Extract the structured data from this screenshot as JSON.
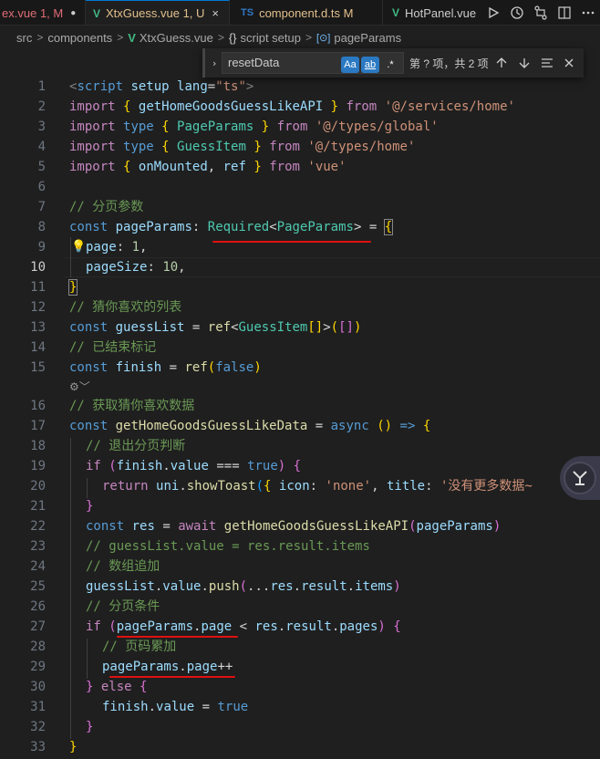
{
  "tabs": [
    {
      "name": "ex.vue",
      "status": "1, M",
      "modified_dot": "●",
      "color": "#e06c75"
    },
    {
      "name": "XtxGuess.vue",
      "status": "1, U",
      "close": "×",
      "color": "#e2c08d",
      "icon": "V"
    },
    {
      "name": "component.d.ts",
      "status": "M",
      "color": "#e2c08d",
      "icon": "TS"
    },
    {
      "name": "HotPanel.vue",
      "icon": "V"
    }
  ],
  "breadcrumb": {
    "items": [
      "src",
      "components",
      "XtxGuess.vue",
      "script setup",
      "pageParams"
    ],
    "separator": ">"
  },
  "find": {
    "value": "resetData",
    "options": [
      "Aa",
      "ab",
      ".*"
    ],
    "result": "第 ? 项，共 2 项"
  },
  "editor": {
    "current_line": 10,
    "codelens_glyph": "⚙︎﹀",
    "lines": [
      {
        "n": "1"
      },
      {
        "n": "2"
      },
      {
        "n": "3"
      },
      {
        "n": "4"
      },
      {
        "n": "5"
      },
      {
        "n": "6"
      },
      {
        "n": "7"
      },
      {
        "n": "8"
      },
      {
        "n": "9"
      },
      {
        "n": "10"
      },
      {
        "n": "11"
      },
      {
        "n": "12"
      },
      {
        "n": "13"
      },
      {
        "n": "14"
      },
      {
        "n": "15"
      },
      {
        "n": "16"
      },
      {
        "n": "17"
      },
      {
        "n": "18"
      },
      {
        "n": "19"
      },
      {
        "n": "20"
      },
      {
        "n": "21"
      },
      {
        "n": "22"
      },
      {
        "n": "23"
      },
      {
        "n": "24"
      },
      {
        "n": "25"
      },
      {
        "n": "26"
      },
      {
        "n": "27"
      },
      {
        "n": "28"
      },
      {
        "n": "29"
      },
      {
        "n": "30"
      },
      {
        "n": "31"
      },
      {
        "n": "32"
      },
      {
        "n": "33"
      }
    ],
    "code": {
      "l1_tag": "script",
      "l1_attr1": "setup",
      "l1_attr2": "lang",
      "l1_val": "\"ts\"",
      "import": "import",
      "from": "from",
      "type": "type",
      "const": "const",
      "await": "await",
      "async": "async",
      "l2_name": "getHomeGoodsGuessLikeAPI",
      "l2_path": "'@/services/home'",
      "l3_name": "PageParams",
      "l3_path": "'@/types/global'",
      "l4_name": "GuessItem",
      "l4_path": "'@/types/home'",
      "l5_name1": "onMounted",
      "l5_name2": "ref",
      "l5_path": "'vue'",
      "l7_comment": "// 分页参数",
      "l8_var": "pageParams",
      "l8_req": "Required",
      "l8_type": "PageParams",
      "l9_key": "page",
      "l9_val": "1",
      "l10_key": "pageSize",
      "l10_val": "10",
      "l12_comment": "// 猜你喜欢的列表",
      "l13_var": "guessList",
      "l13_fn": "ref",
      "l13_type": "GuessItem",
      "l14_comment": "// 已结束标记",
      "l15_var": "finish",
      "l15_fn": "ref",
      "l15_val": "false",
      "l16_comment": "// 获取猜你喜欢数据",
      "l17_var": "getHomeGoodsGuessLikeData",
      "l18_comment": "// 退出分页判断",
      "if": "if",
      "l19_obj": "finish",
      "l19_prop": "value",
      "l19_val": "true",
      "return": "return",
      "l20_obj": "uni",
      "l20_fn": "showToast",
      "l20_k1": "icon",
      "l20_v1": "'none'",
      "l20_k2": "title",
      "l20_v2": "'没有更多数据~",
      "l22_var": "res",
      "l22_fn": "getHomeGoodsGuessLikeAPI",
      "l22_arg": "pageParams",
      "l23_comment": "// guessList.value = res.result.items",
      "l24_comment": "// 数组追加",
      "l25_a": "guessList",
      "l25_b": "value",
      "l25_fn": "push",
      "l25_c": "res",
      "l25_d": "result",
      "l25_e": "items",
      "l26_comment": "// 分页条件",
      "l27_a": "pageParams",
      "l27_b": "page",
      "l27_c": "res",
      "l27_d": "result",
      "l27_e": "pages",
      "l28_comment": "// 页码累加",
      "l29_a": "pageParams",
      "l29_b": "page",
      "else": "else",
      "l31_a": "finish",
      "l31_b": "value",
      "l31_val": "true"
    }
  },
  "colors": {
    "accent": "#0078d4",
    "annotation_red": "#e01010"
  }
}
